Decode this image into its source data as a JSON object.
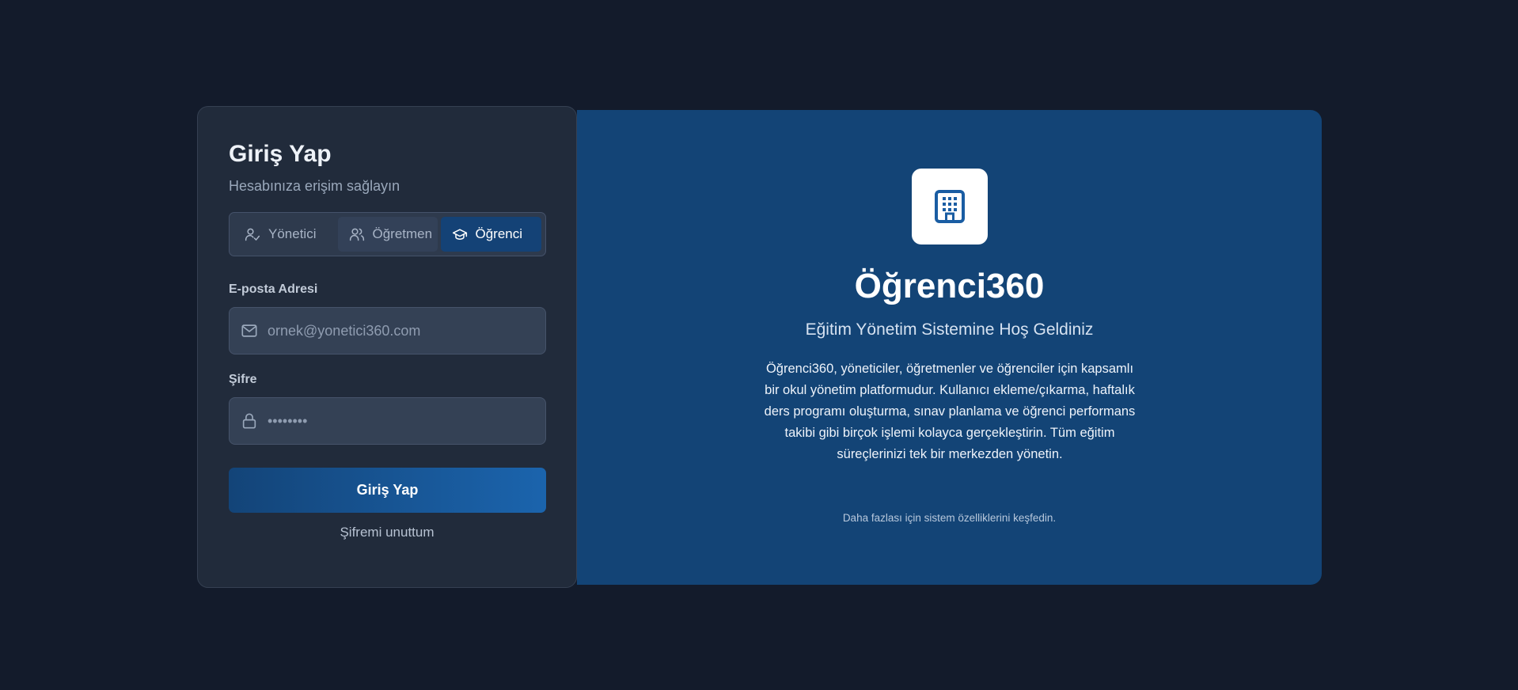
{
  "login": {
    "title": "Giriş Yap",
    "subtitle": "Hesabınıza erişim sağlayın",
    "roles": [
      {
        "label": "Yönetici",
        "icon": "user-check-icon",
        "selected": false
      },
      {
        "label": "Öğretmen",
        "icon": "users-icon",
        "selected": false
      },
      {
        "label": "Öğrenci",
        "icon": "graduation-cap-icon",
        "selected": true
      }
    ],
    "email": {
      "label": "E-posta Adresi",
      "placeholder": "ornek@yonetici360.com",
      "value": "",
      "icon": "mail-icon"
    },
    "password": {
      "label": "Şifre",
      "placeholder": "••••••••",
      "value": "",
      "icon": "lock-icon"
    },
    "submit_label": "Giriş Yap",
    "forgot_label": "Şifremi unuttum"
  },
  "info": {
    "icon": "building-icon",
    "brand": "Öğrenci360",
    "tagline": "Eğitim Yönetim Sistemine Hoş Geldiniz",
    "description": "Öğrenci360, yöneticiler, öğretmenler ve öğrenciler için kapsamlı bir okul yönetim platformudur. Kullanıcı ekleme/çıkarma, haftalık ders programı oluşturma, sınav planlama ve öğrenci performans takibi gibi birçok işlemi kolayca gerçekleştirin. Tüm eğitim süreçlerinizi tek bir merkezden yönetin.",
    "more": "Daha fazlası için sistem özelliklerini keşfedin."
  },
  "colors": {
    "background": "#131b2b",
    "card": "#212b3b",
    "panel": "#134476",
    "accent": "#1b64ad"
  }
}
